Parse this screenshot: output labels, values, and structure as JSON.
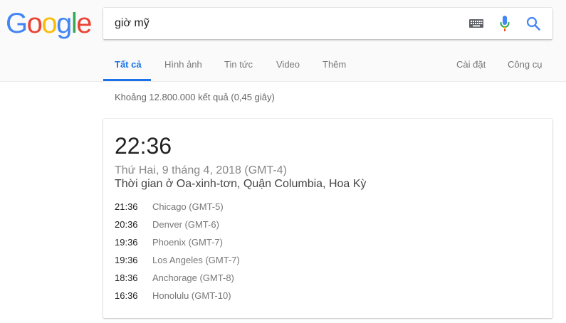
{
  "logo": {
    "letters": [
      "G",
      "o",
      "o",
      "g",
      "l",
      "e"
    ],
    "colors": [
      "#4285F4",
      "#EA4335",
      "#FBBC05",
      "#4285F4",
      "#34A853",
      "#EA4335"
    ]
  },
  "search": {
    "query": "giờ mỹ"
  },
  "tabs": [
    {
      "label": "Tất cả",
      "active": true
    },
    {
      "label": "Hình ảnh"
    },
    {
      "label": "Tin tức"
    },
    {
      "label": "Video"
    },
    {
      "label": "Thêm"
    }
  ],
  "tools": {
    "settings": "Cài đặt",
    "tools": "Công cụ"
  },
  "stats": "Khoảng 12.800.000 kết quả (0,45 giây)",
  "card": {
    "time": "22:36",
    "date": "Thứ Hai, 9 tháng 4, 2018 (GMT-4)",
    "location": "Thời gian ở Oa-xinh-tơn, Quận Columbia, Hoa Kỳ",
    "zones": [
      {
        "time": "21:36",
        "city": "Chicago (GMT-5)"
      },
      {
        "time": "20:36",
        "city": "Denver (GMT-6)"
      },
      {
        "time": "19:36",
        "city": "Phoenix (GMT-7)"
      },
      {
        "time": "19:36",
        "city": "Los Angeles (GMT-7)"
      },
      {
        "time": "18:36",
        "city": "Anchorage (GMT-8)"
      },
      {
        "time": "16:36",
        "city": "Honolulu (GMT-10)"
      }
    ]
  },
  "accent": "#1a73e8"
}
